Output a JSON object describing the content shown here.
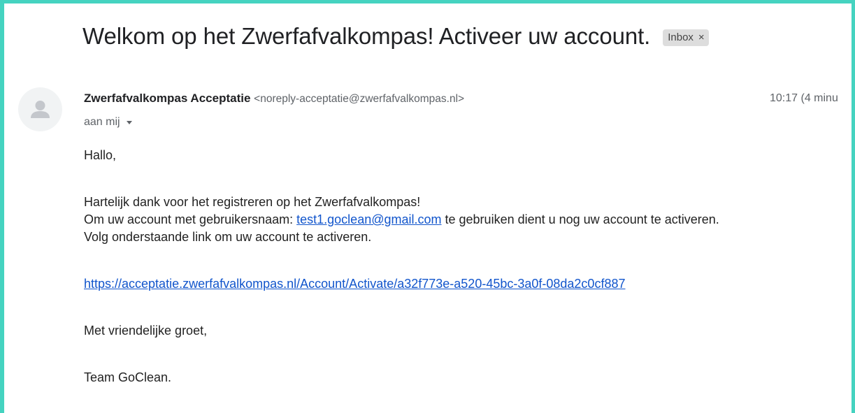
{
  "email": {
    "subject": "Welkom op het Zwerfafvalkompas! Activeer uw account.",
    "label": "Inbox",
    "label_remove": "×",
    "sender": {
      "name": "Zwerfafvalkompas Acceptatie",
      "email": "<noreply-acceptatie@zwerfafvalkompas.nl>",
      "avatar_icon": "default-person-icon"
    },
    "time": "10:17 (4 minu",
    "recipient": "aan mij",
    "body": {
      "greeting": "Hallo,",
      "line1": "Hartelijk dank voor het registreren op het Zwerfafvalkompas!",
      "line2_prefix": "Om uw account met gebruikersnaam: ",
      "line2_link": "test1.goclean@gmail.com",
      "line2_suffix": " te gebruiken dient u nog uw account te activeren.",
      "line3": "Volg onderstaande link om uw account te activeren.",
      "activation_link": "https://acceptatie.zwerfafvalkompas.nl/Account/Activate/a32f773e-a520-45bc-3a0f-08da2c0cf887",
      "closing": "Met vriendelijke groet,",
      "signature": "Team GoClean."
    }
  },
  "colors": {
    "frame_border": "#45d3c0",
    "link": "#1155cc",
    "label_bg": "#dddddd"
  }
}
